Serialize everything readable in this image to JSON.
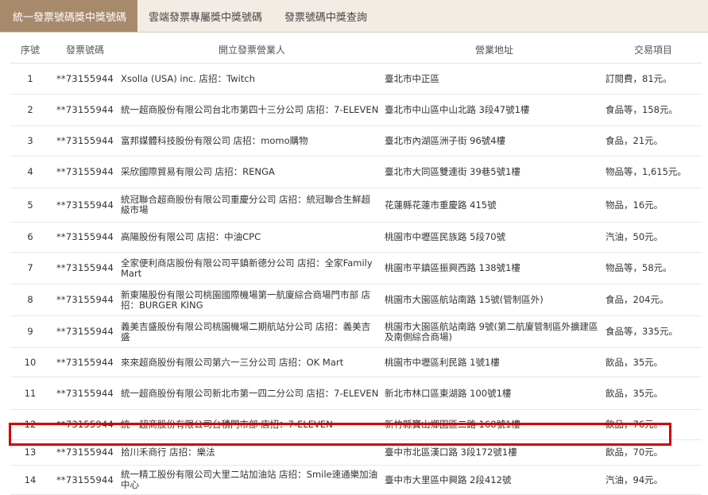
{
  "tabs": [
    {
      "label": "統一發票號碼獎中獎號碼"
    },
    {
      "label": "雲端發票專屬獎中獎號碼"
    },
    {
      "label": "發票號碼中獎查詢"
    }
  ],
  "table": {
    "headers": [
      "序號",
      "發票號碼",
      "開立發票營業人",
      "營業地址",
      "交易項目"
    ],
    "rows": [
      {
        "no": "1",
        "invoice": "**73155944",
        "business": "Xsolla (USA) inc. 店招：Twitch",
        "address": "臺北市中正區",
        "item": "訂閱費，81元。"
      },
      {
        "no": "2",
        "invoice": "**73155944",
        "business": "統一超商股份有限公司台北市第四十三分公司 店招：7-ELEVEN",
        "address": "臺北市中山區中山北路 3段47號1樓",
        "item": "食品等，158元。"
      },
      {
        "no": "3",
        "invoice": "**73155944",
        "business": "富邦媒體科技股份有限公司 店招：momo購物",
        "address": "臺北市內湖區洲子街 96號4樓",
        "item": "食品，21元。"
      },
      {
        "no": "4",
        "invoice": "**73155944",
        "business": "采欣國際貿易有限公司 店招：RENGA",
        "address": "臺北市大同區雙連街 39巷5號1樓",
        "item": "物品等，1,615元。"
      },
      {
        "no": "5",
        "invoice": "**73155944",
        "business": "統冠聯合超商股份有限公司重慶分公司 店招：統冠聯合生鮮超級市場",
        "address": "花蓮縣花蓮市重慶路 415號",
        "item": "物品，16元。"
      },
      {
        "no": "6",
        "invoice": "**73155944",
        "business": "高陽股份有限公司 店招：中油CPC",
        "address": "桃園市中壢區民族路 5段70號",
        "item": "汽油，50元。"
      },
      {
        "no": "7",
        "invoice": "**73155944",
        "business": "全家便利商店股份有限公司平鎮新德分公司 店招：全家Family Mart",
        "address": "桃園市平鎮區振興西路 138號1樓",
        "item": "物品等，58元。"
      },
      {
        "no": "8",
        "invoice": "**73155944",
        "business": "新東陽股份有限公司桃園國際機場第一航廈綜合商場門市部 店招：BURGER KING",
        "address": "桃園市大園區航站南路 15號(管制區外)",
        "item": "食品，204元。"
      },
      {
        "no": "9",
        "invoice": "**73155944",
        "business": "義美吉盛股份有限公司桃園機場二期航站分公司 店招：義美吉盛",
        "address": "桃園市大園區航站南路 9號(第二航廈管制區外擴建區及南側綜合商場)",
        "item": "食品等，335元。"
      },
      {
        "no": "10",
        "invoice": "**73155944",
        "business": "來來超商股份有限公司第六一三分公司 店招：OK Mart",
        "address": "桃園市中壢區利民路 1號1樓",
        "item": "飲品，35元。"
      },
      {
        "no": "11",
        "invoice": "**73155944",
        "business": "統一超商股份有限公司新北市第一四二分公司 店招：7-ELEVEN",
        "address": "新北市林口區東湖路 100號1樓",
        "item": "飲品，35元。"
      },
      {
        "no": "12",
        "invoice": "**73155944",
        "business": "統一超商股份有限公司台積門市部 店招：7-ELEVEN",
        "address": "新竹縣寶山鄉園區二路 168號1樓",
        "item": "飲品，76元。"
      },
      {
        "no": "13",
        "invoice": "**73155944",
        "business": "拾川禾商行 店招：樂法",
        "address": "臺中市北區漢口路 3段172號1樓",
        "item": "飲品，70元。"
      },
      {
        "no": "14",
        "invoice": "**73155944",
        "business": "統一精工股份有限公司大里二站加油站 店招：Smile速通樂加油中心",
        "address": "臺中市大里區中興路 2段412號",
        "item": "汽油，94元。"
      }
    ]
  },
  "highlight": {
    "row": "13",
    "color": "#d00000"
  },
  "colors": {
    "active_tab": "#a78a6c",
    "tabbar": "#f2ece4"
  }
}
